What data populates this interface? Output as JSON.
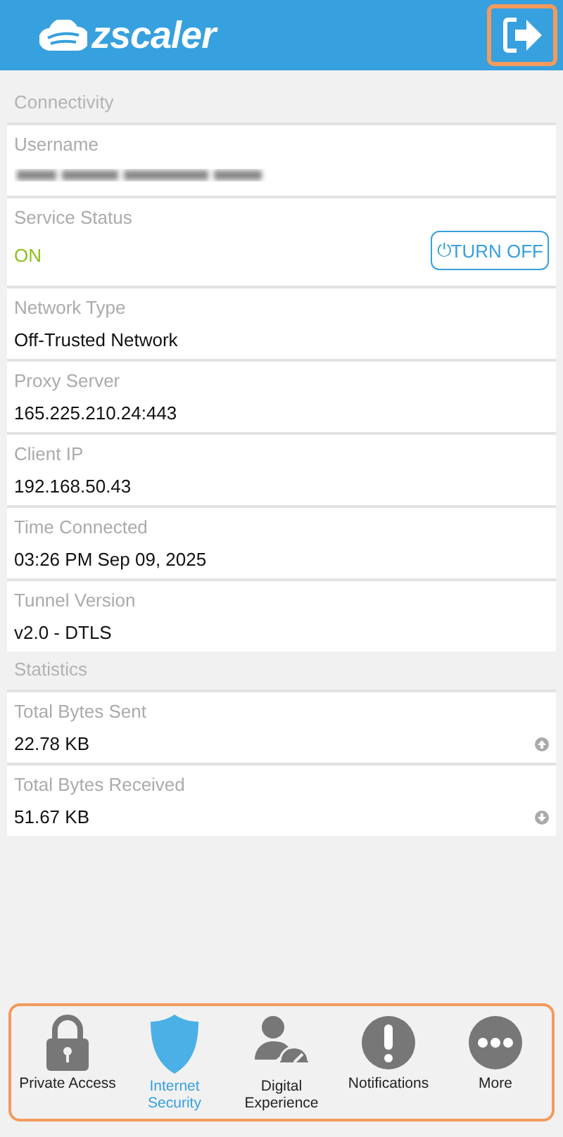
{
  "header": {
    "logo_text": "zscaler"
  },
  "sections": [
    {
      "title": "Connectivity",
      "rows": [
        {
          "kind": "redacted",
          "label": "Username"
        },
        {
          "kind": "status",
          "label": "Service Status",
          "value": "ON",
          "on": true,
          "button": {
            "icon": "⏻",
            "label": "TURN OFF"
          }
        },
        {
          "kind": "text",
          "label": "Network Type",
          "value": "Off-Trusted Network"
        },
        {
          "kind": "text",
          "label": "Proxy Server",
          "value": "165.225.210.24:443"
        },
        {
          "kind": "text",
          "label": "Client IP",
          "value": "192.168.50.43"
        },
        {
          "kind": "text",
          "label": "Time Connected",
          "value": "03:26 PM Sep 09, 2025"
        },
        {
          "kind": "text",
          "label": "Tunnel Version",
          "value": "v2.0 - DTLS"
        }
      ]
    },
    {
      "title": "Statistics",
      "rows": [
        {
          "kind": "upload",
          "label": "Total Bytes Sent",
          "value": "22.78 KB"
        },
        {
          "kind": "download",
          "label": "Total Bytes Received",
          "value": "51.67 KB"
        }
      ]
    }
  ],
  "nav": [
    {
      "kind": "lock",
      "label": "Private Access",
      "selected": false
    },
    {
      "kind": "shield",
      "label": "Internet Security",
      "selected": true
    },
    {
      "kind": "person",
      "label": "Digital Experience",
      "selected": false
    },
    {
      "kind": "alert",
      "label": "Notifications",
      "selected": false
    },
    {
      "kind": "more",
      "label": "More",
      "selected": false
    }
  ]
}
